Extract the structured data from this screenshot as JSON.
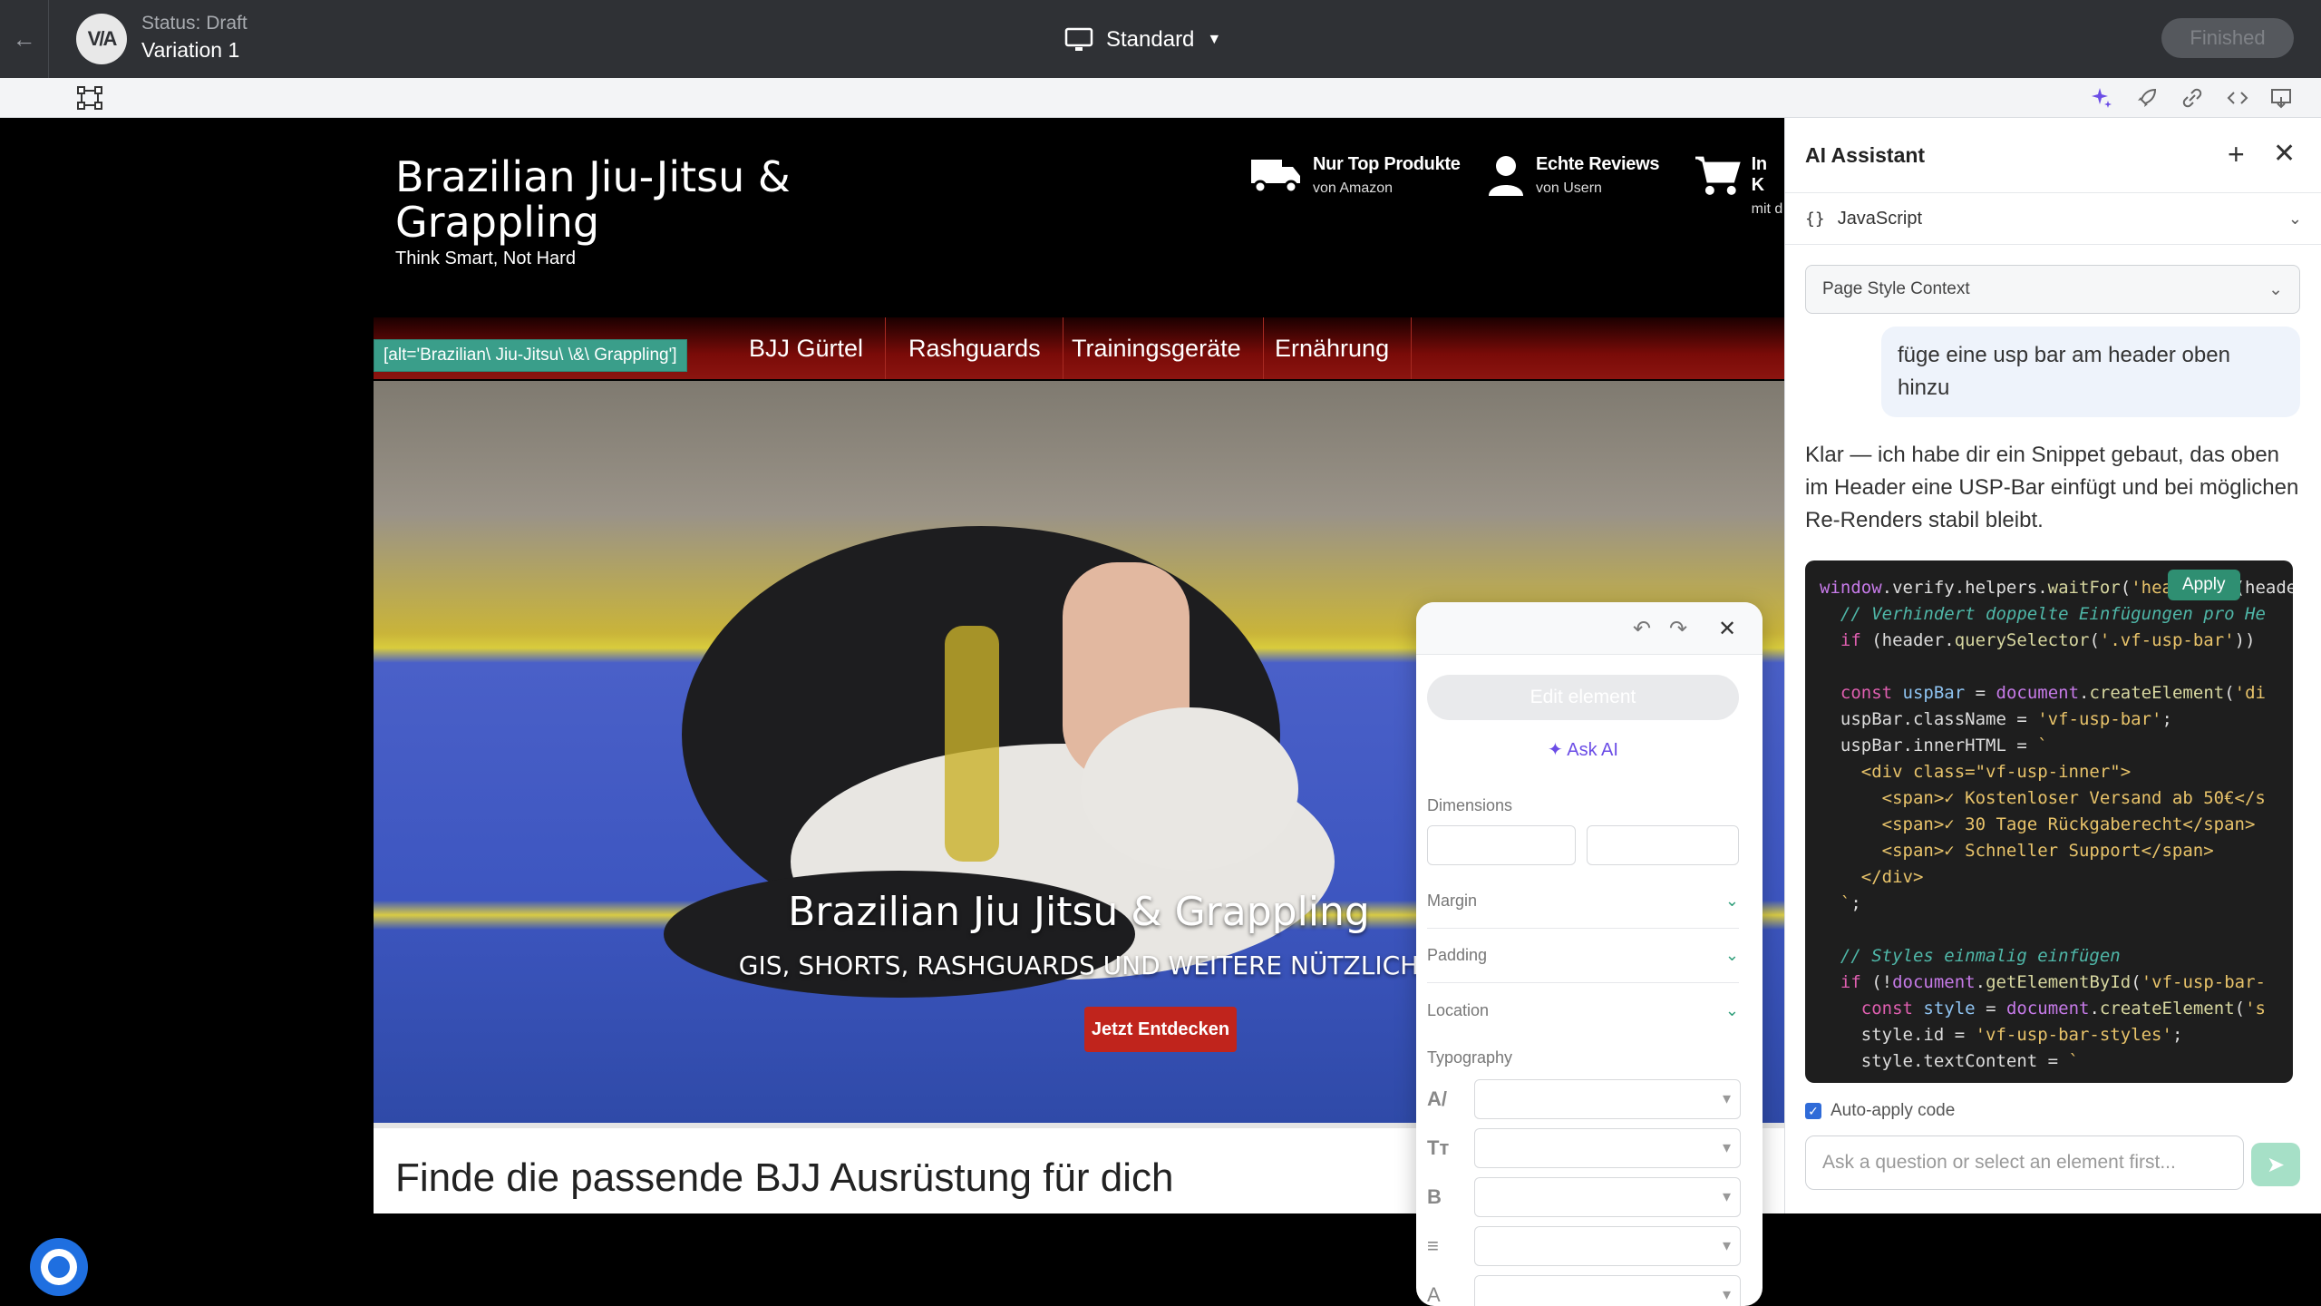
{
  "topbar": {
    "status": "Status: Draft",
    "variation": "Variation 1",
    "logo_text": "V/A",
    "device": "Standard",
    "finished": "Finished"
  },
  "site": {
    "title": "Brazilian Jiu-Jitsu & Grappling",
    "tagline": "Think Smart, Not Hard",
    "usps": [
      {
        "title": "Nur Top Produkte",
        "sub": "von Amazon",
        "icon": "truck-icon"
      },
      {
        "title": "Echte Reviews",
        "sub": "von Usern",
        "icon": "user-icon"
      },
      {
        "title": "In K",
        "sub": "mit d",
        "icon": "cart-icon"
      }
    ],
    "nav": [
      "BJJ Gürtel",
      "Rashguards",
      "Trainingsgeräte",
      "Ernährung"
    ],
    "selector_tag": "[alt='Brazilian\\ Jiu-Jitsu\\ \\&\\ Grappling']",
    "hero_title": "Brazilian Jiu Jitsu & Grappling",
    "hero_sub": "GIS, SHORTS, RASHGUARDS UND WEITERE NÜTZLICH",
    "hero_cta": "Jetzt Entdecken",
    "content_heading": "Finde die passende BJJ Ausrüstung für dich"
  },
  "edit_panel": {
    "edit_element": "Edit element",
    "ask_ai": "Ask AI",
    "dimensions": "Dimensions",
    "margin": "Margin",
    "padding": "Padding",
    "location": "Location",
    "typography": "Typography"
  },
  "ai": {
    "title": "AI Assistant",
    "language": "JavaScript",
    "context": "Page Style Context",
    "user_message": "füge eine usp bar am header oben hinzu",
    "assistant_message": "Klar — ich habe dir ein Snippet gebaut, das oben im Header eine USP-Bar einfügt und bei möglichen Re-Renders stabil bleibt.",
    "apply": "Apply",
    "auto_apply": "Auto-apply code",
    "input_placeholder": "Ask a question or select an element first..."
  },
  "colors": {
    "topbar": "#2f3135",
    "nav_red": "#8c1510",
    "cta_red": "#c0241c",
    "selector_tag": "#3a9e8a",
    "ai_accent": "#6b4de6",
    "apply": "#2f8f72"
  }
}
